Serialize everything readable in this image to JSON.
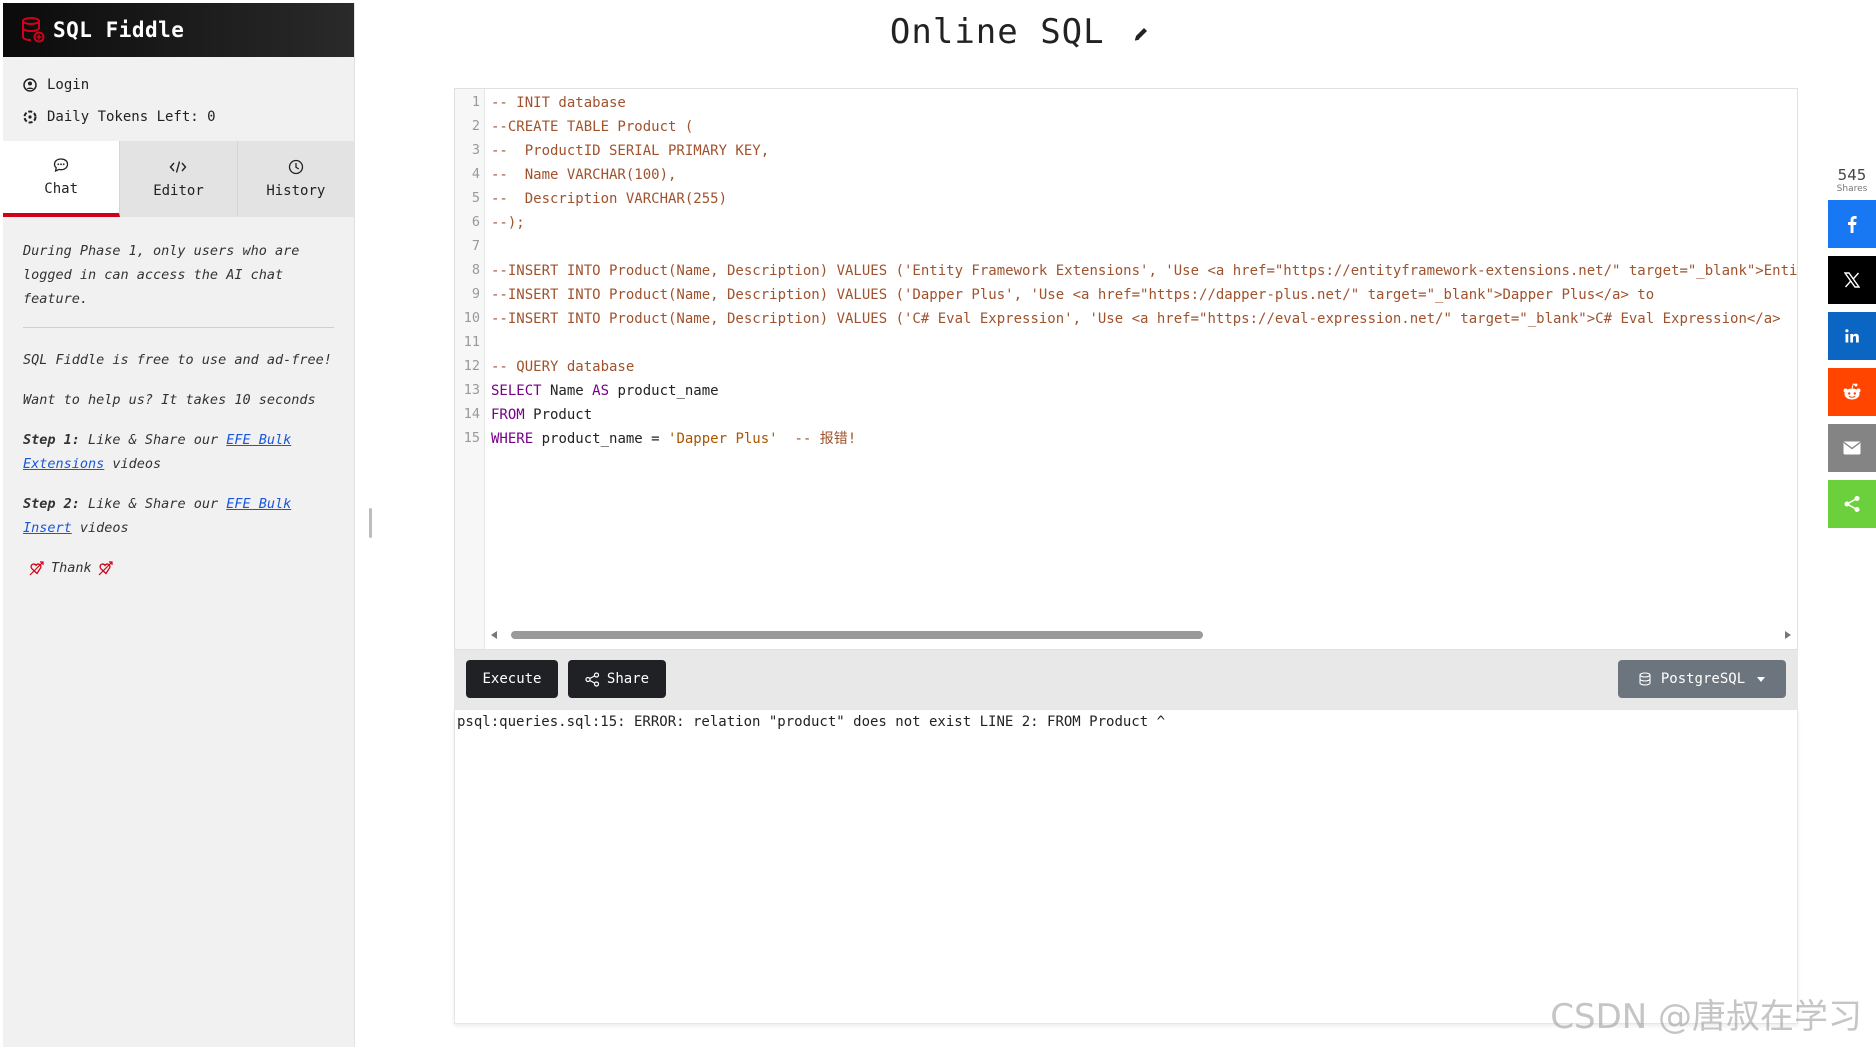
{
  "app": {
    "brand": "SQL Fiddle",
    "page_title": "Online SQL"
  },
  "user": {
    "login": "Login",
    "tokens": "Daily Tokens Left: 0"
  },
  "tabs": [
    {
      "label": "Chat",
      "icon": "chat-icon",
      "active": true
    },
    {
      "label": "Editor",
      "icon": "code-icon",
      "active": false
    },
    {
      "label": "History",
      "icon": "clock-icon",
      "active": false
    }
  ],
  "chat": {
    "notice": "During Phase 1, only users who are logged in can access the AI chat feature.",
    "free": "SQL Fiddle is free to use and ad-free!",
    "help": "Want to help us? It takes 10 seconds",
    "step1_label": "Step 1:",
    "step1_text": " Like & Share our ",
    "step1_link": "EFE Bulk Extensions",
    "step1_suffix": " videos",
    "step2_label": "Step 2:",
    "step2_text": " Like & Share our ",
    "step2_link": "EFE Bulk Insert",
    "step2_suffix": " videos",
    "thanks": "Thank"
  },
  "editor": {
    "line_numbers": [
      "1",
      "2",
      "3",
      "4",
      "5",
      "6",
      "7",
      "8",
      "9",
      "10",
      "11",
      "12",
      "13",
      "14",
      "15"
    ],
    "lines": [
      [
        {
          "t": "-- INIT database",
          "c": "cm"
        }
      ],
      [
        {
          "t": "--CREATE TABLE Product (",
          "c": "cm"
        }
      ],
      [
        {
          "t": "--  ProductID SERIAL PRIMARY KEY,",
          "c": "cm"
        }
      ],
      [
        {
          "t": "--  Name VARCHAR(100),",
          "c": "cm"
        }
      ],
      [
        {
          "t": "--  Description VARCHAR(255)",
          "c": "cm"
        }
      ],
      [
        {
          "t": "--);",
          "c": "cm"
        }
      ],
      [],
      [
        {
          "t": "--INSERT INTO Product(Name, Description) VALUES ('Entity Framework Extensions', 'Use <a href=\"https://entityframework-extensions.net/\" target=\"_blank\">Entity Framework Extensions</a>",
          "c": "cm"
        }
      ],
      [
        {
          "t": "--INSERT INTO Product(Name, Description) VALUES ('Dapper Plus', 'Use <a href=\"https://dapper-plus.net/\" target=\"_blank\">Dapper Plus</a> to",
          "c": "cm"
        }
      ],
      [
        {
          "t": "--INSERT INTO Product(Name, Description) VALUES ('C# Eval Expression', 'Use <a href=\"https://eval-expression.net/\" target=\"_blank\">C# Eval Expression</a>",
          "c": "cm"
        }
      ],
      [],
      [
        {
          "t": "-- QUERY database",
          "c": "cm"
        }
      ],
      [
        {
          "t": "SELECT",
          "c": "kw"
        },
        {
          "t": " Name ",
          "c": "tx"
        },
        {
          "t": "AS",
          "c": "kw"
        },
        {
          "t": " product_name",
          "c": "tx"
        }
      ],
      [
        {
          "t": "FROM",
          "c": "kw"
        },
        {
          "t": " Product",
          "c": "tx"
        }
      ],
      [
        {
          "t": "WHERE",
          "c": "kw"
        },
        {
          "t": " product_name = ",
          "c": "tx"
        },
        {
          "t": "'Dapper Plus'",
          "c": "st"
        },
        {
          "t": "  -- 报错!",
          "c": "cn"
        }
      ]
    ]
  },
  "toolbar": {
    "execute": "Execute",
    "share": "Share",
    "database": "PostgreSQL"
  },
  "output": {
    "message": "psql:queries.sql:15: ERROR: relation \"product\" does not exist LINE 2: FROM Product ^"
  },
  "social": {
    "count": "545",
    "count_label": "Shares",
    "buttons": [
      "facebook-icon",
      "x-icon",
      "linkedin-icon",
      "reddit-icon",
      "email-icon",
      "share-icon"
    ]
  },
  "watermark": "CSDN @唐叔在学习",
  "colors": {
    "accent": "#d0021b",
    "brand_bg": "#0b0b0b",
    "button_dark": "#1f2124",
    "button_grey": "#6c757d"
  }
}
